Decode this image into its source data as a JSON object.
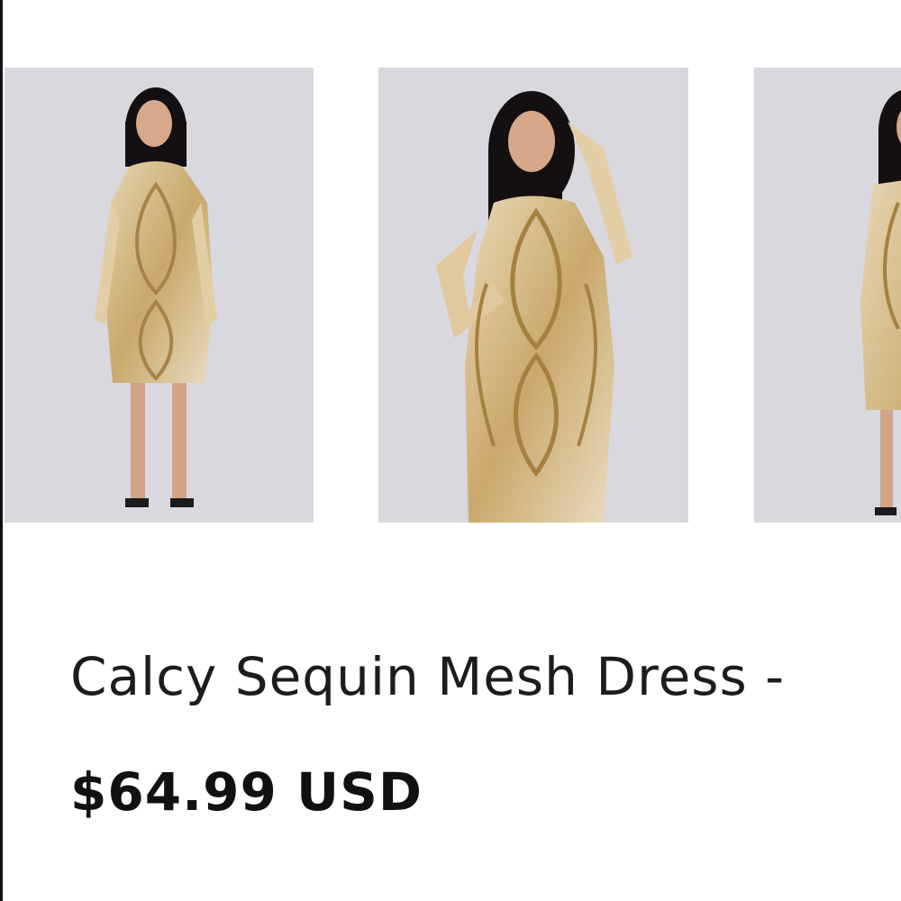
{
  "gallery": {
    "images": [
      {
        "alt": "model-front-full-length"
      },
      {
        "alt": "model-three-quarter-pose"
      },
      {
        "alt": "model-side-view"
      }
    ]
  },
  "product": {
    "title": "Calcy Sequin Mesh Dress -",
    "price": "$64.99 USD"
  },
  "colors": {
    "background": "#ffffff",
    "photo_backdrop": "#d9d8df",
    "dress_gold": "#c9a86a",
    "text": "#1c1c1c"
  }
}
